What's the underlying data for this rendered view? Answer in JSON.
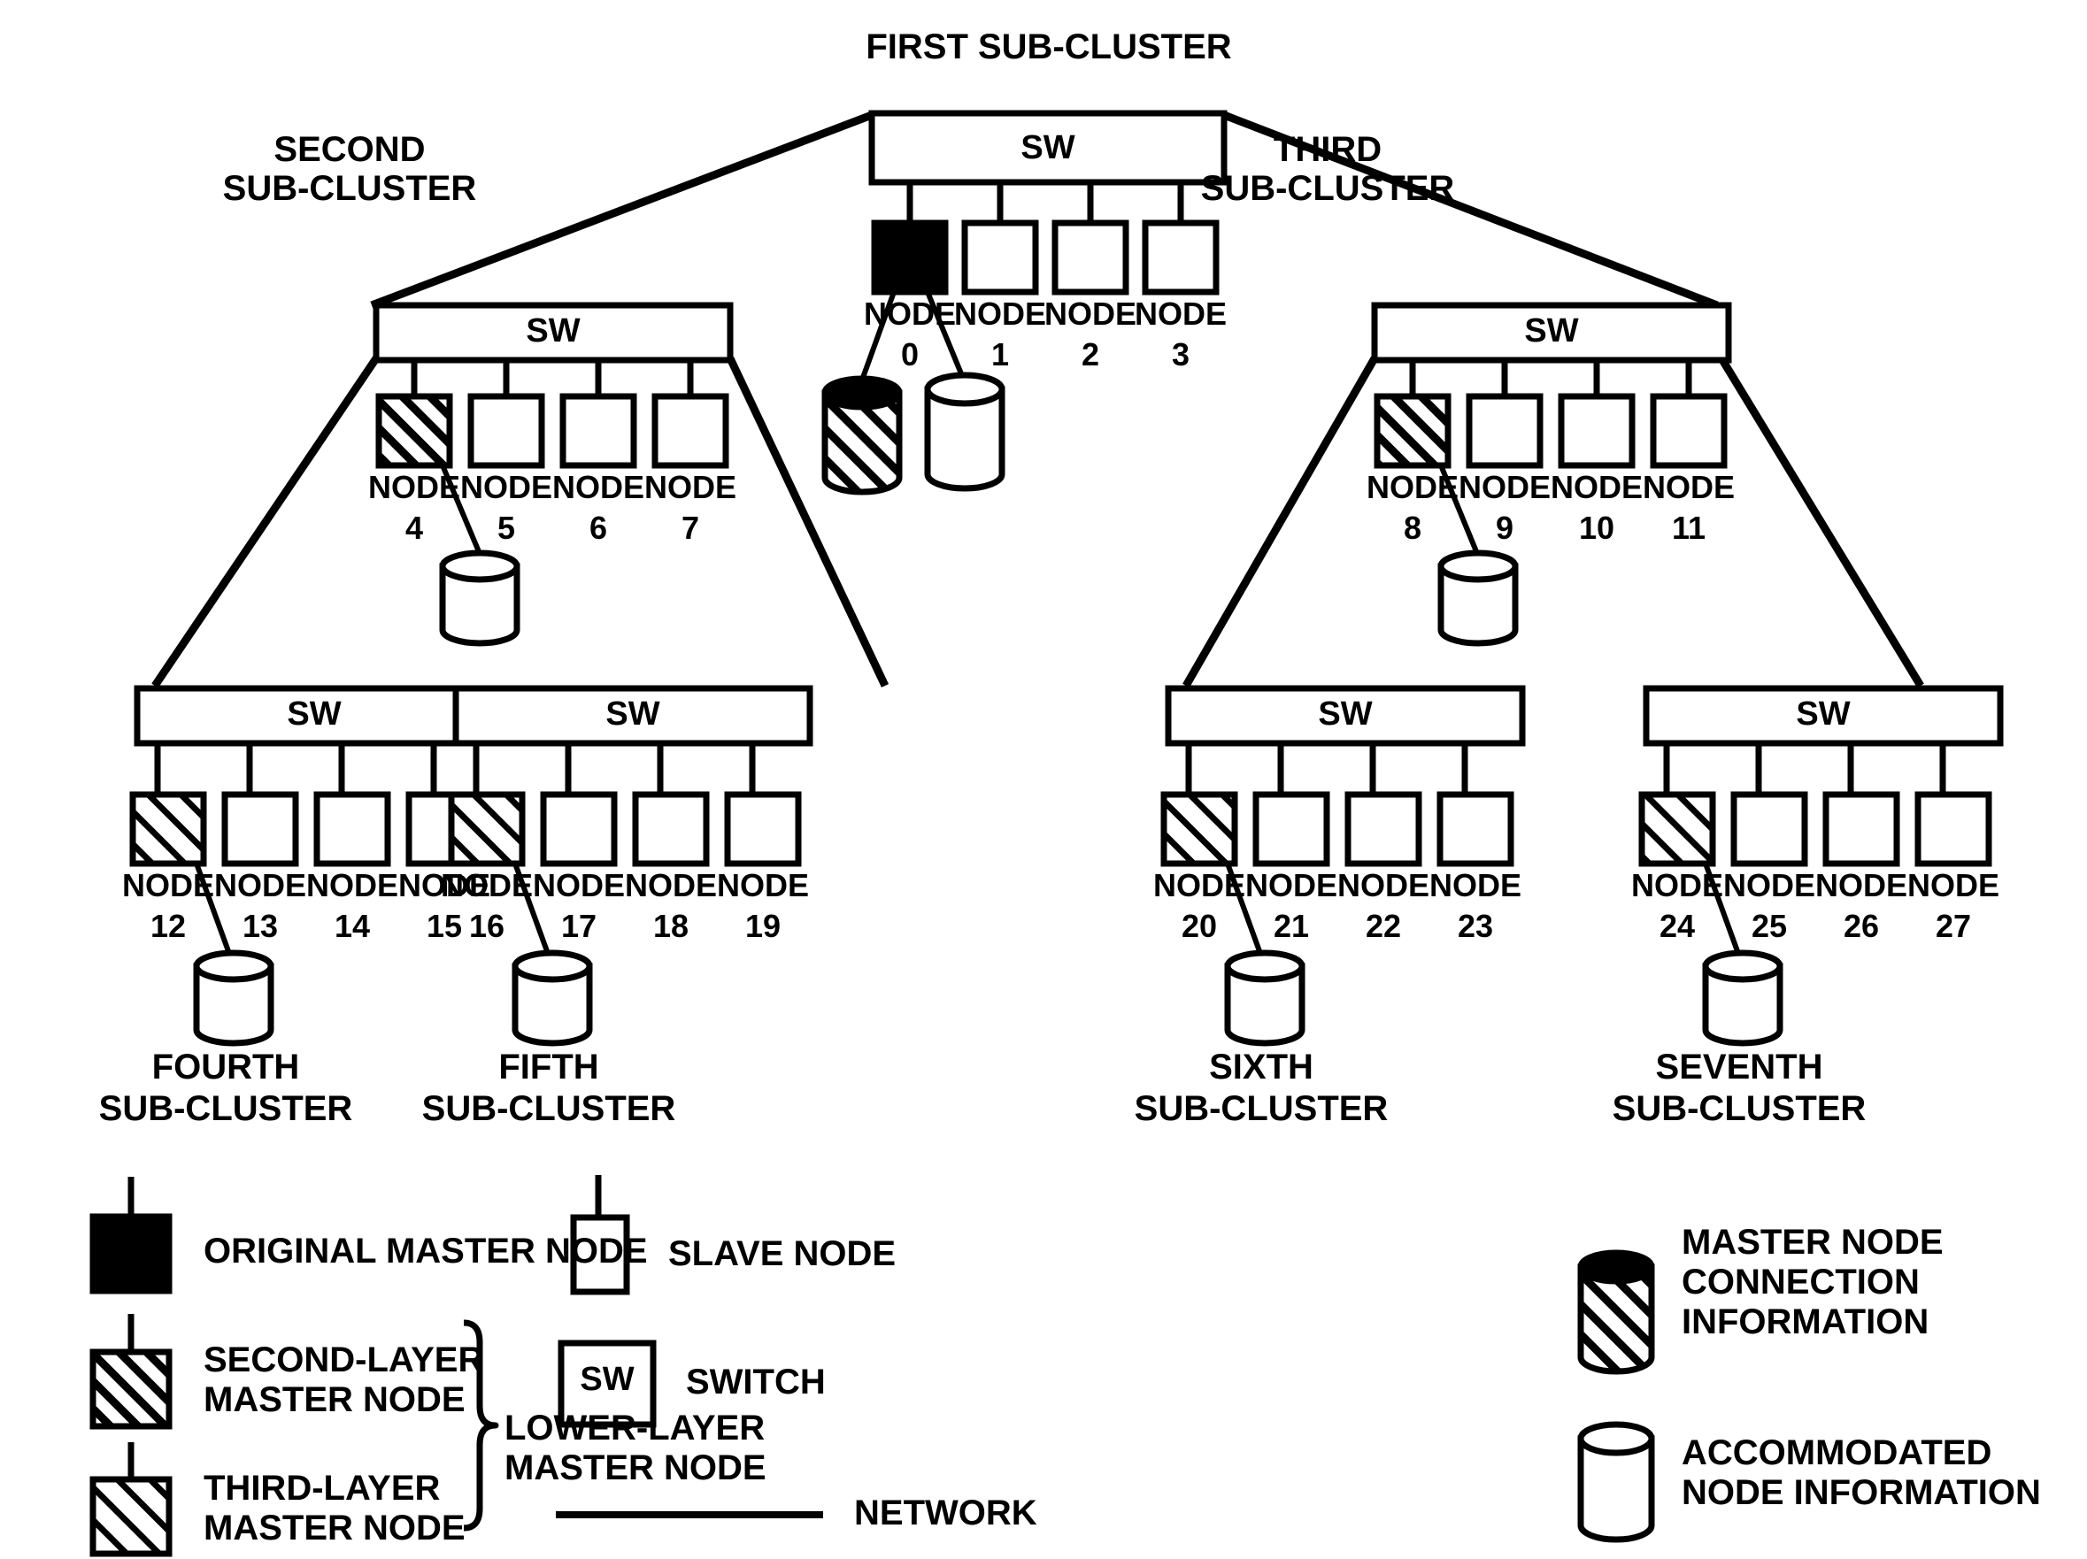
{
  "diagram": {
    "title_visible": false,
    "switch_label": "SW",
    "node_word": "NODE",
    "cluster_titles": {
      "first": "FIRST SUB-CLUSTER",
      "second_line1": "SECOND",
      "second_line2": "SUB-CLUSTER",
      "third_line1": "THIRD",
      "third_line2": "SUB-CLUSTER",
      "fourth_line1": "FOURTH",
      "fourth_line2": "SUB-CLUSTER",
      "fifth_line1": "FIFTH",
      "fifth_line2": "SUB-CLUSTER",
      "sixth_line1": "SIXTH",
      "sixth_line2": "SUB-CLUSTER",
      "seventh_line1": "SEVENTH",
      "seventh_line2": "SUB-CLUSTER"
    },
    "clusters": [
      {
        "name": "first",
        "switch": "SW",
        "nodes": [
          "0",
          "1",
          "2",
          "3"
        ],
        "master_type": "original"
      },
      {
        "name": "second",
        "switch": "SW",
        "nodes": [
          "4",
          "5",
          "6",
          "7"
        ],
        "master_type": "second-layer"
      },
      {
        "name": "third",
        "switch": "SW",
        "nodes": [
          "8",
          "9",
          "10",
          "11"
        ],
        "master_type": "second-layer"
      },
      {
        "name": "fourth",
        "switch": "SW",
        "nodes": [
          "12",
          "13",
          "14",
          "15"
        ],
        "master_type": "third-layer"
      },
      {
        "name": "fifth",
        "switch": "SW",
        "nodes": [
          "16",
          "17",
          "18",
          "19"
        ],
        "master_type": "third-layer"
      },
      {
        "name": "sixth",
        "switch": "SW",
        "nodes": [
          "20",
          "21",
          "22",
          "23"
        ],
        "master_type": "third-layer"
      },
      {
        "name": "seventh",
        "switch": "SW",
        "nodes": [
          "24",
          "25",
          "26",
          "27"
        ],
        "master_type": "third-layer"
      }
    ],
    "node_numbers": {
      "n0": "0",
      "n1": "1",
      "n2": "2",
      "n3": "3",
      "n4": "4",
      "n5": "5",
      "n6": "6",
      "n7": "7",
      "n8": "8",
      "n9": "9",
      "n10": "10",
      "n11": "11",
      "n12": "12",
      "n13": "13",
      "n14": "14",
      "n15": "15",
      "n16": "16",
      "n17": "17",
      "n18": "18",
      "n19": "19",
      "n20": "20",
      "n21": "21",
      "n22": "22",
      "n23": "23",
      "n24": "24",
      "n25": "25",
      "n26": "26",
      "n27": "27"
    }
  },
  "legend": {
    "original_master_node": "ORIGINAL MASTER NODE",
    "second_layer_line1": "SECOND-LAYER",
    "second_layer_line2": "MASTER NODE",
    "third_layer_line1": "THIRD-LAYER",
    "third_layer_line2": "MASTER NODE",
    "lower_layer_line1": "LOWER-LAYER",
    "lower_layer_line2": "MASTER NODE",
    "slave_node": "SLAVE NODE",
    "switch": "SWITCH",
    "switch_symbol": "SW",
    "network": "NETWORK",
    "master_conn_line1": "MASTER NODE",
    "master_conn_line2": "CONNECTION",
    "master_conn_line3": "INFORMATION",
    "accommodated_line1": "ACCOMMODATED",
    "accommodated_line2": "NODE INFORMATION"
  },
  "colors": {
    "ink": "#000000",
    "paper": "#ffffff"
  }
}
